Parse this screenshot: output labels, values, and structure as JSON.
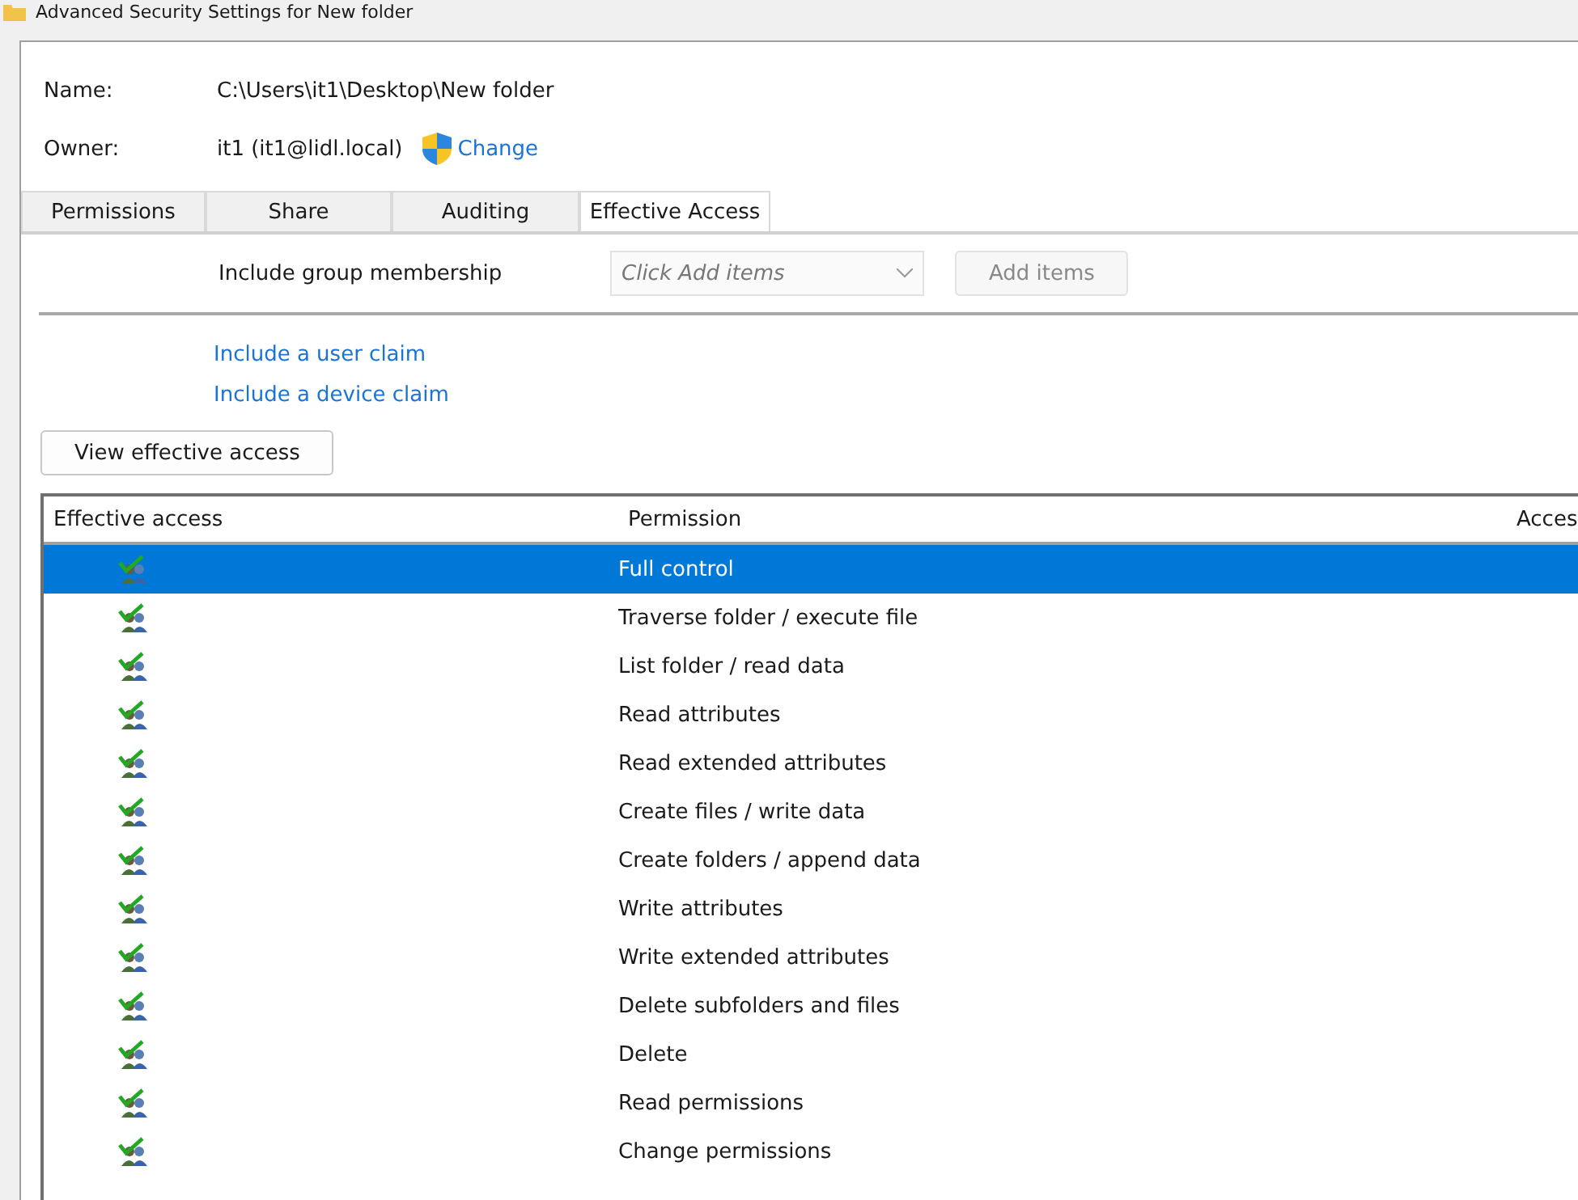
{
  "window": {
    "title": "Advanced Security Settings for New folder"
  },
  "name": {
    "label": "Name:",
    "value": "C:\\Users\\it1\\Desktop\\New folder"
  },
  "owner": {
    "label": "Owner:",
    "value": "it1 (it1@lidl.local)",
    "change_link": "Change"
  },
  "tabs": [
    {
      "label": "Permissions",
      "selected": false
    },
    {
      "label": "Share",
      "selected": false
    },
    {
      "label": "Auditing",
      "selected": false
    },
    {
      "label": "Effective Access",
      "selected": true
    }
  ],
  "group_membership": {
    "label": "Include group membership",
    "placeholder": "Click Add items",
    "button": "Add items",
    "disabled": true
  },
  "links": [
    "Include a user claim",
    "Include a device claim"
  ],
  "view_button": "View effective access",
  "table": {
    "columns": [
      "Effective access",
      "Permission",
      "Acces"
    ],
    "rows": [
      {
        "permission": "Full control",
        "allowed": true,
        "selected": true
      },
      {
        "permission": "Traverse folder / execute file",
        "allowed": true,
        "selected": false
      },
      {
        "permission": "List folder / read data",
        "allowed": true,
        "selected": false
      },
      {
        "permission": "Read attributes",
        "allowed": true,
        "selected": false
      },
      {
        "permission": "Read extended attributes",
        "allowed": true,
        "selected": false
      },
      {
        "permission": "Create files / write data",
        "allowed": true,
        "selected": false
      },
      {
        "permission": "Create folders / append data",
        "allowed": true,
        "selected": false
      },
      {
        "permission": "Write attributes",
        "allowed": true,
        "selected": false
      },
      {
        "permission": "Write extended attributes",
        "allowed": true,
        "selected": false
      },
      {
        "permission": "Delete subfolders and files",
        "allowed": true,
        "selected": false
      },
      {
        "permission": "Delete",
        "allowed": true,
        "selected": false
      },
      {
        "permission": "Read permissions",
        "allowed": true,
        "selected": false
      },
      {
        "permission": "Change permissions",
        "allowed": true,
        "selected": false
      }
    ]
  }
}
